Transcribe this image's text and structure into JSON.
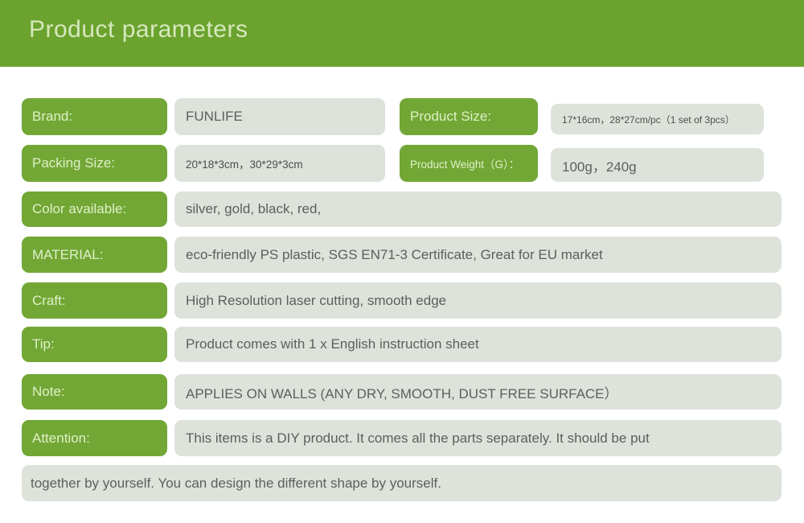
{
  "header": {
    "title": "Product parameters",
    "background_color": "#6ba32e",
    "text_color": "#d6e8bd"
  },
  "theme": {
    "label_pill_color": "#72a736",
    "label_text_color": "#dff0c6",
    "value_box_color": "#dde3da",
    "value_text_color": "#5e5e5e"
  },
  "rows": [
    {
      "label": "Brand:",
      "value": "FUNLIFE",
      "label2": "Product Size:",
      "value2": "17*16cm，28*27cm/pc（1 set of 3pcs）"
    },
    {
      "label": "Packing Size:",
      "value": "20*18*3cm，30*29*3cm",
      "label2": "Product Weight（G）：",
      "value2": "100g，240g"
    },
    {
      "label": "Color available:",
      "value": "silver, gold, black, red,"
    },
    {
      "label": "MATERIAL:",
      "value": "eco-friendly PS plastic, SGS EN71-3 Certificate, Great for EU market"
    },
    {
      "label": "Craft:",
      "value": "High Resolution laser cutting, smooth edge"
    },
    {
      "label": "Tip:",
      "value": "Product comes with 1 x English instruction sheet"
    },
    {
      "label": "Note:",
      "value": "APPLIES ON WALLS (ANY DRY, SMOOTH, DUST FREE SURFACE）"
    },
    {
      "label": "Attention:",
      "value": "This items is a DIY product. It comes all the parts separately. It should be put"
    }
  ],
  "continuation": {
    "value": "together by yourself. You can design the different shape by yourself."
  }
}
